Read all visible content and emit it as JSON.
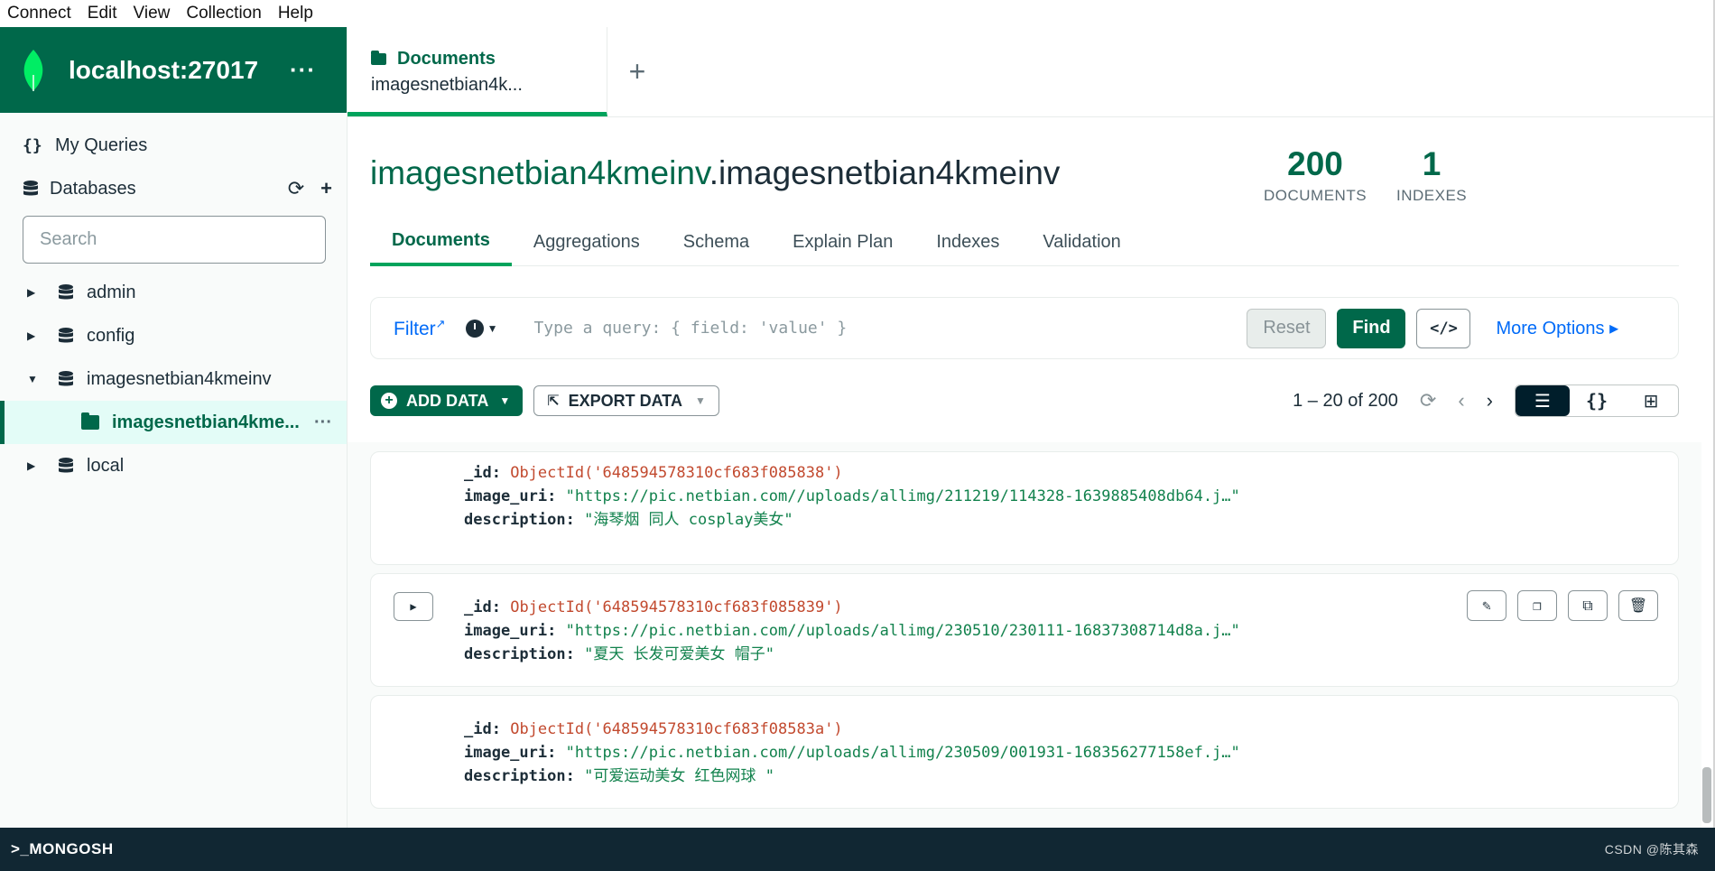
{
  "menu": [
    "Connect",
    "Edit",
    "View",
    "Collection",
    "Help"
  ],
  "connection": {
    "title": "localhost:27017",
    "more": "···"
  },
  "sidebar": {
    "my_queries": "My Queries",
    "databases": "Databases",
    "search_placeholder": "Search",
    "tree": [
      {
        "label": "admin",
        "expanded": false
      },
      {
        "label": "config",
        "expanded": false
      },
      {
        "label": "imagesnetbian4kmeinv",
        "expanded": true
      },
      {
        "label": "imagesnetbian4kme...",
        "collection": true,
        "active": true
      },
      {
        "label": "local",
        "expanded": false
      }
    ]
  },
  "tab": {
    "kind": "Documents",
    "name": "imagesnetbian4k...",
    "add": "+"
  },
  "namespace": {
    "db": "imagesnetbian4kmeinv",
    "dot": ".",
    "collection": "imagesnetbian4kmeinv"
  },
  "stats": {
    "documents": "200",
    "documents_label": "DOCUMENTS",
    "indexes": "1",
    "indexes_label": "INDEXES"
  },
  "subtabs": [
    "Documents",
    "Aggregations",
    "Schema",
    "Explain Plan",
    "Indexes",
    "Validation"
  ],
  "query": {
    "filter_label": "Filter",
    "placeholder": "Type a query: { field: 'value' }",
    "reset": "Reset",
    "find": "Find",
    "code": "</>",
    "more_options": "More Options ▸"
  },
  "toolbar": {
    "add_data": "ADD DATA",
    "export_data": "EXPORT DATA",
    "pager": "1 – 20 of 200"
  },
  "documents": [
    {
      "id_key": "_id",
      "id_value": "ObjectId('648594578310cf683f085838')",
      "uri_key": "image_uri",
      "uri_value": "\"https://pic.netbian.com//uploads/allimg/211219/114328-1639885408db64.j…\"",
      "desc_key": "description",
      "desc_value": "\"海琴烟 同人 cosplay美女\""
    },
    {
      "id_key": "_id",
      "id_value": "ObjectId('648594578310cf683f085839')",
      "uri_key": "image_uri",
      "uri_value": "\"https://pic.netbian.com//uploads/allimg/230510/230111-16837308714d8a.j…\"",
      "desc_key": "description",
      "desc_value": "\"夏天 长发可爱美女 帽子\""
    },
    {
      "id_key": "_id",
      "id_value": "ObjectId('648594578310cf683f08583a')",
      "uri_key": "image_uri",
      "uri_value": "\"https://pic.netbian.com//uploads/allimg/230509/001931-168356277158ef.j…\"",
      "desc_key": "description",
      "desc_value": "\"可爱运动美女 红色网球 \""
    }
  ],
  "shell": {
    "label": ">_MONGOSH",
    "watermark": "CSDN @陈其森"
  }
}
